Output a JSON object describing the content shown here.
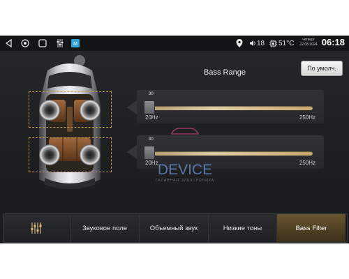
{
  "status_bar": {
    "icons": [
      "back-icon",
      "home-icon",
      "recents-icon",
      "equalizer-icon",
      "app-icon",
      "location-icon",
      "volume-icon",
      "temperature-icon"
    ],
    "volume": "18",
    "temperature": "51°C",
    "weekday": "четверг",
    "date": "22.08.2024",
    "time": "06:18"
  },
  "screen": {
    "title": "Bass Range",
    "default_button": "По умолч."
  },
  "sliders": [
    {
      "value": "30",
      "min_label": "20Hz",
      "max_label": "250Hz",
      "fraction": 0.0
    },
    {
      "value": "30",
      "min_label": "20Hz",
      "max_label": "250Hz",
      "fraction": 0.0
    }
  ],
  "watermark": {
    "brand": "DEVICE",
    "sub": "ГАЛАВНАЯ ЭЛЕКТРОНИКА"
  },
  "tabs": [
    {
      "label": "",
      "icon": "equalizer-sliders-icon",
      "active": false
    },
    {
      "label": "Звуковое поле",
      "active": false
    },
    {
      "label": "Объемный звук",
      "active": false
    },
    {
      "label": "Низкие тоны",
      "active": false
    },
    {
      "label": "Bass Filter",
      "active": true
    }
  ],
  "colors": {
    "accent": "#c8a052",
    "active_tab": "#5a4828",
    "background": "#1e1f21"
  }
}
